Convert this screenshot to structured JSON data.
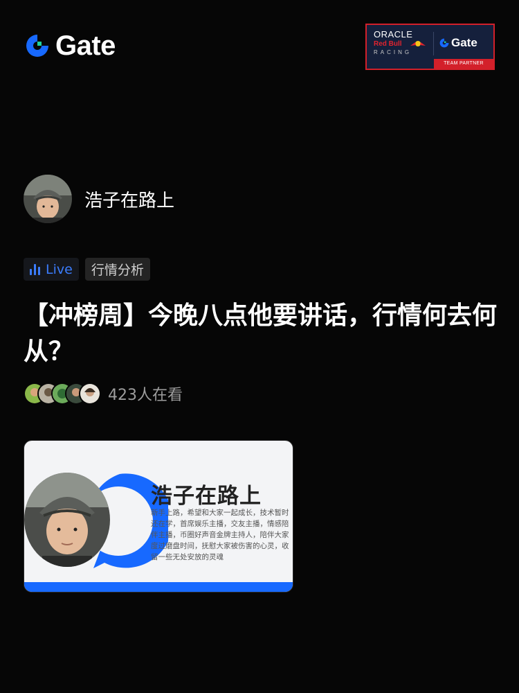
{
  "brand": {
    "logo_text": "Gate",
    "logo_icon": "gate-logo-icon"
  },
  "partner_badge": {
    "oracle": "ORACLE",
    "red_bull": "Red Bull",
    "racing": "RACING",
    "gate": "Gate",
    "team_partner": "TEAM PARTNER"
  },
  "host": {
    "name": "浩子在路上",
    "avatar_icon": "host-avatar"
  },
  "tags": {
    "live": "Live",
    "category": "行情分析"
  },
  "stream": {
    "title": "【冲榜周】今晚八点他要讲话，行情何去何从？"
  },
  "viewers": {
    "text": "423人在看",
    "avatar_count": 5
  },
  "cover": {
    "name": "浩子在路上",
    "bio": "新手上路，希望和大家一起成长，技术暂时还在学，首席娱乐主播，交友主播，情感陪伴主播，币圈好声音金牌主持人，陪伴大家度过磨盘时间，抚慰大家被伤害的心灵，收留一些无处安放的灵魂"
  },
  "colors": {
    "accent": "#1769ff",
    "live_blue": "#3b7dff",
    "gate_green": "#1fd2a0",
    "background": "#060606"
  }
}
